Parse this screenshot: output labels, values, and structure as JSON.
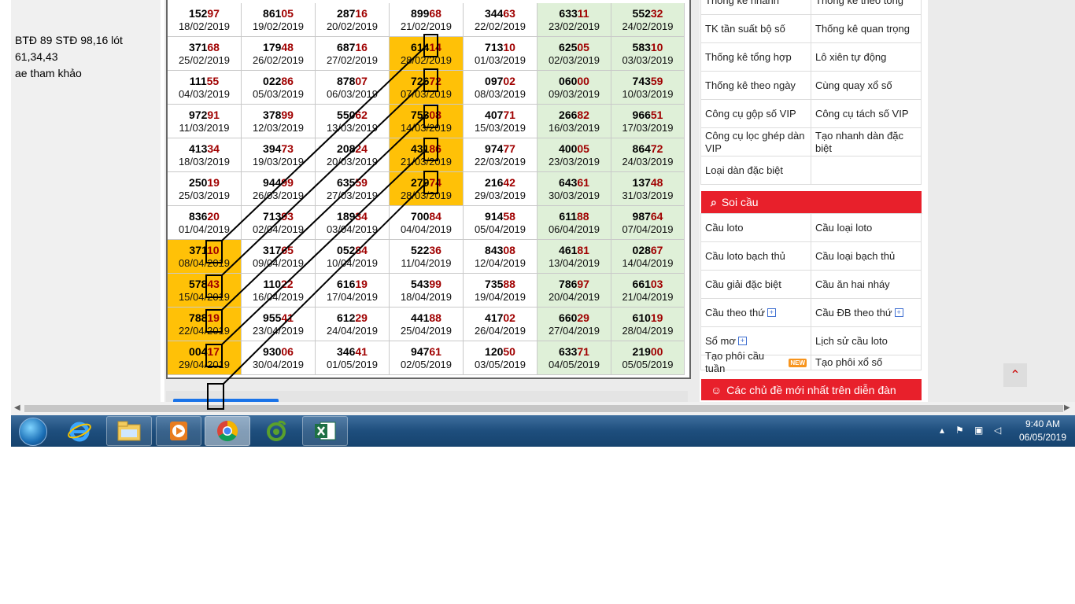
{
  "note": {
    "lines": [
      "BTĐ 89 STĐ 98,16 lót",
      "61,34,43",
      "ae tham khảo"
    ]
  },
  "table": {
    "rows": [
      [
        {
          "head": "152",
          "tail": "97",
          "date": "18/02/2019"
        },
        {
          "head": "861",
          "tail": "05",
          "date": "19/02/2019"
        },
        {
          "head": "287",
          "tail": "16",
          "date": "20/02/2019"
        },
        {
          "head": "899",
          "tail": "68",
          "date": "21/02/2019"
        },
        {
          "head": "344",
          "tail": "63",
          "date": "22/02/2019"
        },
        {
          "head": "633",
          "tail": "11",
          "date": "23/02/2019"
        },
        {
          "head": "552",
          "tail": "32",
          "date": "24/02/2019"
        }
      ],
      [
        {
          "head": "371",
          "tail": "68",
          "date": "25/02/2019"
        },
        {
          "head": "179",
          "tail": "48",
          "date": "26/02/2019"
        },
        {
          "head": "687",
          "tail": "16",
          "date": "27/02/2019"
        },
        {
          "head": "614",
          "tail": "14",
          "date": "28/02/2019"
        },
        {
          "head": "713",
          "tail": "10",
          "date": "01/03/2019"
        },
        {
          "head": "625",
          "tail": "05",
          "date": "02/03/2019"
        },
        {
          "head": "583",
          "tail": "10",
          "date": "03/03/2019"
        }
      ],
      [
        {
          "head": "111",
          "tail": "55",
          "date": "04/03/2019"
        },
        {
          "head": "022",
          "tail": "86",
          "date": "05/03/2019"
        },
        {
          "head": "878",
          "tail": "07",
          "date": "06/03/2019"
        },
        {
          "head": "726",
          "tail": "72",
          "date": "07/03/2019"
        },
        {
          "head": "097",
          "tail": "02",
          "date": "08/03/2019"
        },
        {
          "head": "060",
          "tail": "00",
          "date": "09/03/2019"
        },
        {
          "head": "743",
          "tail": "59",
          "date": "10/03/2019"
        }
      ],
      [
        {
          "head": "972",
          "tail": "91",
          "date": "11/03/2019"
        },
        {
          "head": "378",
          "tail": "99",
          "date": "12/03/2019"
        },
        {
          "head": "550",
          "tail": "62",
          "date": "13/03/2019"
        },
        {
          "head": "753",
          "tail": "08",
          "date": "14/03/2019"
        },
        {
          "head": "407",
          "tail": "71",
          "date": "15/03/2019"
        },
        {
          "head": "266",
          "tail": "82",
          "date": "16/03/2019"
        },
        {
          "head": "966",
          "tail": "51",
          "date": "17/03/2019"
        }
      ],
      [
        {
          "head": "413",
          "tail": "34",
          "date": "18/03/2019"
        },
        {
          "head": "394",
          "tail": "73",
          "date": "19/03/2019"
        },
        {
          "head": "208",
          "tail": "24",
          "date": "20/03/2019"
        },
        {
          "head": "431",
          "tail": "86",
          "date": "21/03/2019"
        },
        {
          "head": "974",
          "tail": "77",
          "date": "22/03/2019"
        },
        {
          "head": "400",
          "tail": "05",
          "date": "23/03/2019"
        },
        {
          "head": "864",
          "tail": "72",
          "date": "24/03/2019"
        }
      ],
      [
        {
          "head": "250",
          "tail": "19",
          "date": "25/03/2019"
        },
        {
          "head": "944",
          "tail": "99",
          "date": "26/03/2019"
        },
        {
          "head": "635",
          "tail": "59",
          "date": "27/03/2019"
        },
        {
          "head": "279",
          "tail": "74",
          "date": "28/03/2019"
        },
        {
          "head": "216",
          "tail": "42",
          "date": "29/03/2019"
        },
        {
          "head": "643",
          "tail": "61",
          "date": "30/03/2019"
        },
        {
          "head": "137",
          "tail": "48",
          "date": "31/03/2019"
        }
      ],
      [
        {
          "head": "836",
          "tail": "20",
          "date": "01/04/2019"
        },
        {
          "head": "713",
          "tail": "93",
          "date": "02/04/2019"
        },
        {
          "head": "189",
          "tail": "34",
          "date": "03/04/2019"
        },
        {
          "head": "700",
          "tail": "84",
          "date": "04/04/2019"
        },
        {
          "head": "914",
          "tail": "58",
          "date": "05/04/2019"
        },
        {
          "head": "611",
          "tail": "88",
          "date": "06/04/2019"
        },
        {
          "head": "987",
          "tail": "64",
          "date": "07/04/2019"
        }
      ],
      [
        {
          "head": "371",
          "tail": "10",
          "date": "08/04/2019"
        },
        {
          "head": "317",
          "tail": "65",
          "date": "09/04/2019"
        },
        {
          "head": "052",
          "tail": "84",
          "date": "10/04/2019"
        },
        {
          "head": "522",
          "tail": "36",
          "date": "11/04/2019"
        },
        {
          "head": "843",
          "tail": "08",
          "date": "12/04/2019"
        },
        {
          "head": "461",
          "tail": "81",
          "date": "13/04/2019"
        },
        {
          "head": "028",
          "tail": "67",
          "date": "14/04/2019"
        }
      ],
      [
        {
          "head": "578",
          "tail": "43",
          "date": "15/04/2019"
        },
        {
          "head": "110",
          "tail": "22",
          "date": "16/04/2019"
        },
        {
          "head": "616",
          "tail": "19",
          "date": "17/04/2019"
        },
        {
          "head": "543",
          "tail": "99",
          "date": "18/04/2019"
        },
        {
          "head": "735",
          "tail": "88",
          "date": "19/04/2019"
        },
        {
          "head": "786",
          "tail": "97",
          "date": "20/04/2019"
        },
        {
          "head": "661",
          "tail": "03",
          "date": "21/04/2019"
        }
      ],
      [
        {
          "head": "788",
          "tail": "19",
          "date": "22/04/2019"
        },
        {
          "head": "955",
          "tail": "41",
          "date": "23/04/2019"
        },
        {
          "head": "612",
          "tail": "29",
          "date": "24/04/2019"
        },
        {
          "head": "441",
          "tail": "88",
          "date": "25/04/2019"
        },
        {
          "head": "417",
          "tail": "02",
          "date": "26/04/2019"
        },
        {
          "head": "660",
          "tail": "29",
          "date": "27/04/2019"
        },
        {
          "head": "610",
          "tail": "19",
          "date": "28/04/2019"
        }
      ],
      [
        {
          "head": "004",
          "tail": "17",
          "date": "29/04/2019"
        },
        {
          "head": "930",
          "tail": "06",
          "date": "30/04/2019"
        },
        {
          "head": "346",
          "tail": "41",
          "date": "01/05/2019"
        },
        {
          "head": "947",
          "tail": "61",
          "date": "02/05/2019"
        },
        {
          "head": "120",
          "tail": "50",
          "date": "03/05/2019"
        },
        {
          "head": "633",
          "tail": "71",
          "date": "04/05/2019"
        },
        {
          "head": "219",
          "tail": "00",
          "date": "05/05/2019"
        }
      ]
    ],
    "highlighted": [
      [
        1,
        3
      ],
      [
        2,
        3
      ],
      [
        3,
        3
      ],
      [
        4,
        3
      ],
      [
        5,
        3
      ],
      [
        7,
        0
      ],
      [
        8,
        0
      ],
      [
        9,
        0
      ],
      [
        10,
        0
      ]
    ],
    "colors": {
      "highlight": "#ffc107",
      "weekend": "#dff0d8",
      "tail": "#a00000"
    }
  },
  "sidebar": {
    "stats_partial": [
      "Thống kê nhanh",
      "Thống kê theo tổng"
    ],
    "stats_rows": [
      [
        "TK tần suất bộ số",
        "Thống kê quan trọng"
      ],
      [
        "Thống kê tổng hợp",
        "Lô xiên tự động"
      ],
      [
        "Thống kê theo ngày",
        "Cùng quay xổ số"
      ],
      [
        "Công cụ gộp số VIP",
        "Công cụ tách số VIP"
      ],
      [
        "Công cụ lọc ghép dàn VIP",
        "Tạo nhanh dàn đặc biệt"
      ],
      [
        "Loại dàn đặc biệt",
        ""
      ]
    ],
    "soicau_title": "Soi cầu",
    "soicau_rows": [
      [
        "Cầu loto",
        "Cầu loại loto"
      ],
      [
        "Cầu loto bạch thủ",
        "Cầu loại bạch thủ"
      ],
      [
        "Cầu giải đặc biệt",
        "Cầu ăn hai nháy"
      ],
      [
        "Cầu theo thứ",
        "Cầu ĐB theo thứ"
      ],
      [
        "Sổ mơ",
        "Lịch sử cầu loto"
      ],
      [
        "Tạo phôi cầu tuần",
        "Tạo phôi xổ số"
      ]
    ],
    "new_badge": "NEW",
    "forum_title": "Các chủ đề mới nhất trên diễn đàn",
    "accent": "#e8202b"
  },
  "taskbar": {
    "apps": [
      "start-button",
      "internet-explorer",
      "file-explorer",
      "media-player",
      "google-chrome",
      "coccoc-browser",
      "microsoft-excel"
    ],
    "time": "9:40 AM",
    "date": "06/05/2019"
  }
}
